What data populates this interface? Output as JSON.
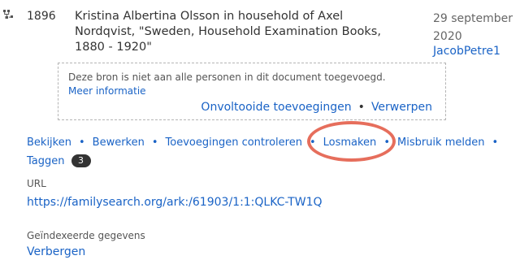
{
  "source": {
    "icon": "family-tree-icon",
    "year": "1896",
    "title": "Kristina Albertina Olsson in household of Axel Nordqvist, \"Sweden, Household Examination Books, 1880 - 1920\"",
    "date": "29 september 2020",
    "contributor": "JacobPetre1"
  },
  "notice": {
    "text": "Deze bron is niet aan alle personen in dit document toegevoegd.",
    "more_link": "Meer informatie",
    "actions": {
      "pending": "Onvoltooide toevoegingen",
      "reject": "Verwerpen"
    }
  },
  "actions": {
    "view": "Bekijken",
    "edit": "Bewerken",
    "review": "Toevoegingen controleren",
    "detach": "Losmaken",
    "report": "Misbruik melden",
    "tags": "Taggen",
    "tags_count": "3"
  },
  "url": {
    "label": "URL",
    "value": "https://familysearch.org/ark:/61903/1:1:QLKC-TW1Q"
  },
  "indexed": {
    "label": "Geïndexeerde gegevens",
    "toggle": "Verbergen"
  },
  "colors": {
    "link": "#1a63c6",
    "highlight": "#e66e5c",
    "badge": "#333333"
  }
}
